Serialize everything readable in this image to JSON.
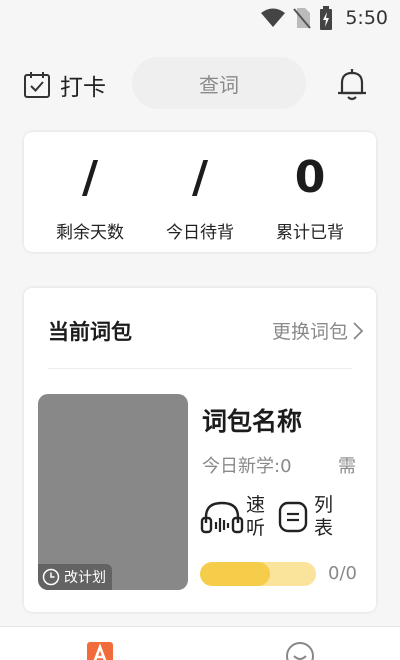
{
  "status_bar": {
    "time": "5:50",
    "icons": [
      "wifi-icon",
      "no-sim-icon",
      "battery-charging-icon"
    ]
  },
  "header": {
    "checkin_label": "打卡",
    "search_placeholder": "查词",
    "icons": [
      "calendar-check-icon",
      "bell-icon"
    ]
  },
  "stats": [
    {
      "value": "/",
      "label": "剩余天数"
    },
    {
      "value": "/",
      "label": "今日待背"
    },
    {
      "value": "0",
      "label": "累计已背"
    }
  ],
  "book": {
    "section_title": "当前词包",
    "change_label": "更换词包",
    "plan_label": "改计划",
    "name": "词包名称",
    "today_new": "今日新学:0",
    "need": "需",
    "actions": [
      {
        "label": "速听",
        "icon": "headphones-icon"
      },
      {
        "label": "列表",
        "icon": "list-icon"
      }
    ],
    "progress_text": "0/0",
    "progress_fraction": 0.6
  },
  "colors": {
    "accent": "#f6cd4a",
    "accent_light": "#fae39a",
    "tab_active": "#f26b3a",
    "cover": "#888888"
  },
  "bottom_nav": {
    "icons": [
      "app-logo-icon",
      "smiley-icon"
    ]
  }
}
